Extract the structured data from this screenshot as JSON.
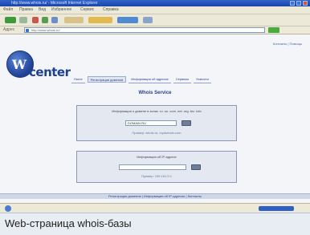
{
  "window": {
    "title": "http://www.whois.ru/ - Microsoft Internet Explorer"
  },
  "menubar": {
    "items": [
      "Файл",
      "Правка",
      "Вид",
      "Избранное",
      "Сервис",
      "Справка"
    ]
  },
  "toolbar": {
    "buttons": [
      "back-icon",
      "forward-icon",
      "stop-icon",
      "refresh-icon",
      "home-icon",
      "search-icon",
      "favorites-icon",
      "media-icon",
      "history-icon"
    ]
  },
  "address": {
    "label": "Адрес",
    "url": "http://www.whois.ru/"
  },
  "site": {
    "logo_letters": "W",
    "logo_word": "center",
    "top_link": "Контакты | Помощь",
    "nav": [
      "Home",
      "Регистрация доменов",
      "Информация об адресах",
      "Сервисы",
      "Новости"
    ],
    "active_nav": 1
  },
  "main": {
    "heading": "Whois Service",
    "domain_search": {
      "description": "Информация о домене в зонах .ru .su .com .net .org .biz .info",
      "value": "DOMAIN.RU",
      "note": "Пример: whois.ru, mydomain.com"
    },
    "ip_search": {
      "description": "Информация об IP-адресе",
      "value": "",
      "note": "Пример: 195.161.5.1"
    }
  },
  "footer": {
    "links": "Регистрация доменов | Информация об IP-адресах | Контакты"
  },
  "caption": {
    "text": "Web-страница whois-базы"
  },
  "colors": {
    "brand": "#1e3f92",
    "titlebar": "#1b45a8",
    "caption_bg": "#e7edf2"
  }
}
